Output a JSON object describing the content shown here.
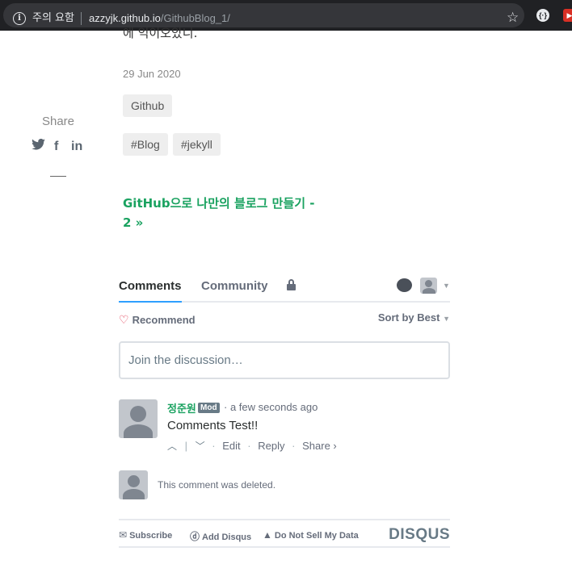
{
  "browser": {
    "security_label": "주의 요함",
    "url_host": "azzyjk.github.io",
    "url_path": "/GithubBlog_1/"
  },
  "post": {
    "cut_text": "에 익이오았니.",
    "date": "29 Jun 2020",
    "category": "Github",
    "tags": [
      "#Blog",
      "#jekyll"
    ],
    "next_post": "GitHub으로 나만의 블로그 만들기 - 2 »"
  },
  "share": {
    "label": "Share",
    "icons": [
      "twitter-icon",
      "facebook-icon",
      "linkedin-icon"
    ]
  },
  "disqus": {
    "tabs": {
      "comments": "Comments",
      "community": "Community"
    },
    "recommend": "Recommend",
    "sort": "Sort by Best",
    "input_placeholder": "Join the discussion…",
    "comment": {
      "author": "정준원",
      "badge": "Mod",
      "time": "a few seconds ago",
      "text": "Comments Test!!",
      "actions": {
        "edit": "Edit",
        "reply": "Reply",
        "share": "Share ›"
      }
    },
    "deleted_text": "This comment was deleted.",
    "footer": {
      "subscribe": "Subscribe",
      "add_disqus": "Add Disqus",
      "do_not_sell": "Do Not Sell My Data",
      "logo": "DISQUS"
    },
    "colors": {
      "author_green": "#1aa260",
      "recommend_heart": "#e0324b"
    }
  }
}
